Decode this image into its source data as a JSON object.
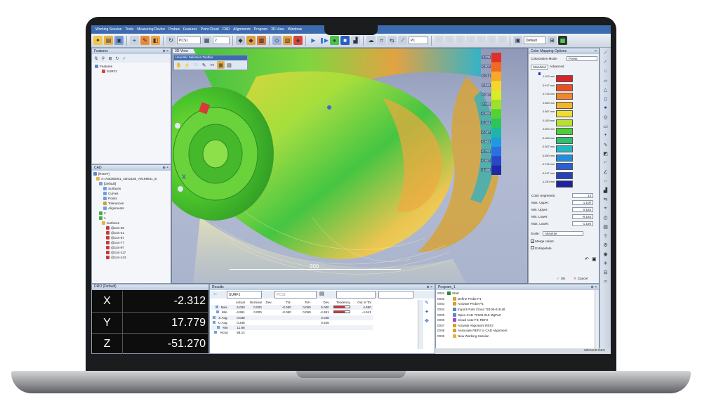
{
  "menu": [
    "Working Session",
    "Tools",
    "Measuring Device",
    "Probes",
    "Features",
    "Point Cloud",
    "CAD",
    "Alignments",
    "Program",
    "3D-View",
    "Windows"
  ],
  "toolbar": {
    "cs_combo": "PCS1",
    "scale_combo": "2",
    "probe_combo": "P1",
    "view_combo": "Default"
  },
  "features_panel": {
    "title": "Features",
    "root": "Features",
    "item": "SURF1"
  },
  "cad_panel": {
    "title": "CAD",
    "rows": [
      "[ROOT]",
      "A=735355001_sdm2160_A#189641_B",
      "[Default]",
      "Surfaces",
      "Curves",
      "Points",
      "Tolerances",
      "Alignments",
      "3",
      "1",
      "Surfaces",
      "@144-25",
      "@144-41",
      "@144-57",
      "@144-77",
      "@144-97",
      "@144-117",
      "@144-143"
    ]
  },
  "viewport": {
    "tab": "3D-View",
    "floating_toolbar_title": "Heuristic Selection Toolbar",
    "scale_label": "200",
    "colorbar_labels": [
      "1.100",
      "0.907",
      "0.713",
      "0.520",
      "0.327",
      "0.133",
      "-0.060",
      "-0.153",
      "-0.347",
      "-0.540",
      "-0.733",
      "-0.927",
      "-1.150"
    ],
    "colorbar_colors": [
      "#e0302a",
      "#f06a24",
      "#f7a826",
      "#f4d72a",
      "#d8ec2a",
      "#9ee02a",
      "#52d233",
      "#2cc55a",
      "#1fb6a6",
      "#1e9be0",
      "#2b6fe0",
      "#2a47c8",
      "#1d2aa8"
    ]
  },
  "color_mapping": {
    "title": "Color Mapping Options",
    "mode_label": "Colorization Mode:",
    "mode_value": "Points",
    "tab_standard": "Standard",
    "tab_advanced": "Advanced",
    "swatches": [
      {
        "label": "1.100 mm",
        "color": "#d7262b"
      },
      {
        "label": "0.917 mm",
        "color": "#ea4f23"
      },
      {
        "label": "0.733 mm",
        "color": "#f2862a"
      },
      {
        "label": "0.550 mm",
        "color": "#f4b52d"
      },
      {
        "label": "0.367 mm",
        "color": "#eedd2e"
      },
      {
        "label": "0.183 mm",
        "color": "#b7e030"
      },
      {
        "label": "0.000 mm",
        "color": "#4ccf35"
      },
      {
        "label": "-0.183 mm",
        "color": "#2cc06f"
      },
      {
        "label": "-0.367 mm",
        "color": "#24b7c2"
      },
      {
        "label": "-0.550 mm",
        "color": "#1f8ee0"
      },
      {
        "label": "-0.733 mm",
        "color": "#2a5fd8"
      },
      {
        "label": "-0.917 mm",
        "color": "#2740bb"
      },
      {
        "label": "-1.150 mm",
        "color": "#1c239c"
      }
    ],
    "fields": [
      {
        "label": "Color Segments:",
        "value": "13"
      },
      {
        "label": "Max. Upper:",
        "value": "1.100"
      },
      {
        "label": "Min. Upper:",
        "value": "0.183"
      },
      {
        "label": "Min. Lower:",
        "value": "-0.183"
      },
      {
        "label": "Max. Lower:",
        "value": "-1.150"
      }
    ],
    "scale_label": "Scale:",
    "scale_value": "Absolute",
    "merge_colors": "Merge colors",
    "extrapolate": "Extrapolate",
    "ok": "OK",
    "cancel": "Cancel"
  },
  "dro": {
    "title": "DRO (Default)",
    "rows": [
      {
        "axis": "X",
        "value": "-2.312"
      },
      {
        "axis": "Y",
        "value": "17.779"
      },
      {
        "axis": "Z",
        "value": "-51.270"
      }
    ]
  },
  "results": {
    "title": "Results",
    "feature_combo": "SURF1",
    "cs_combo": "PCS1",
    "headers": [
      "",
      "Actual",
      "Nominal",
      "Dev",
      "Tol-",
      "Tol+",
      "Dev",
      "Tendency",
      "Out of Tol"
    ],
    "rows": [
      [
        "Max.",
        "5.000",
        "0.000",
        "",
        "-0.060",
        "0.060",
        "5.000",
        "",
        "4.950"
      ],
      [
        "Min.",
        "-4.991",
        "0.000",
        "",
        "-0.060",
        "0.060",
        "-4.991",
        "",
        "-4.941"
      ],
      [
        "S.Avg.",
        "0.038",
        "",
        "",
        "",
        "",
        "0.038",
        "",
        ""
      ],
      [
        "U.Avg.",
        "0.346",
        "",
        "",
        "",
        "",
        "0.346",
        "",
        ""
      ],
      [
        "%In",
        "11.86",
        "",
        "",
        "",
        "",
        "",
        "",
        ""
      ],
      [
        "%Out",
        "88.14",
        "",
        "",
        "",
        "",
        "",
        "",
        ""
      ]
    ]
  },
  "program": {
    "title": "Program_1",
    "rows": [
      {
        "num": "0001",
        "text": "Start"
      },
      {
        "num": "0002",
        "text": "Define Probe P1"
      },
      {
        "num": "0003",
        "text": "Activate Probe P1"
      },
      {
        "num": "0004",
        "text": "Import Point Cloud 70106-016.stl"
      },
      {
        "num": "0005",
        "text": "Open CAD 70106-016 MgPart"
      },
      {
        "num": "0006",
        "text": "Cloud Auto-Fit: REF2"
      },
      {
        "num": "0007",
        "text": "Activate Alignment REF2"
      },
      {
        "num": "0008",
        "text": "Associate REF2 to CAD Alignment"
      },
      {
        "num": "0009",
        "text": "New Working Session"
      }
    ]
  },
  "status": "MM  MAR  DEG",
  "colors": {
    "accent": "#3d6bb0",
    "panel": "#f4f6f9"
  }
}
